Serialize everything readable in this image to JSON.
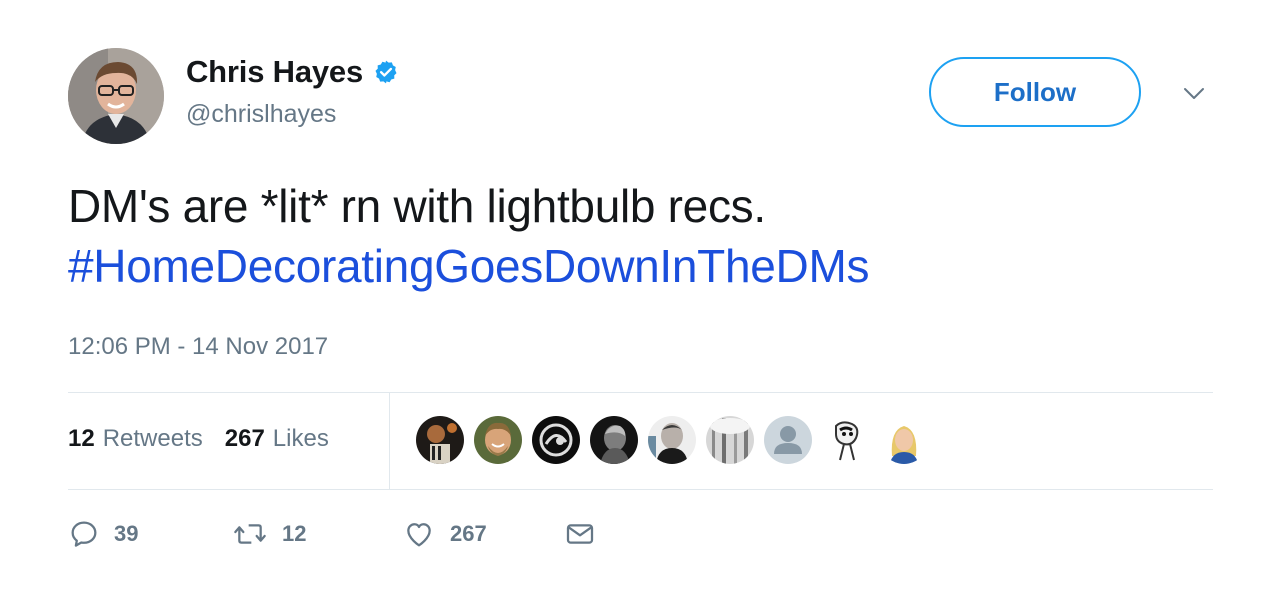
{
  "author": {
    "name": "Chris Hayes",
    "handle": "@chrislhayes",
    "verified": true
  },
  "follow_button": {
    "label": "Follow"
  },
  "tweet": {
    "text": "DM's are *lit* rn with lightbulb recs.",
    "hashtag": "#HomeDecoratingGoesDownInTheDMs",
    "timestamp": "12:06 PM - 14 Nov 2017"
  },
  "stats": {
    "retweets_count": "12",
    "retweets_label": "Retweets",
    "likes_count": "267",
    "likes_label": "Likes"
  },
  "liker_avatars_count": 9,
  "actions": {
    "reply_count": "39",
    "retweet_count": "12",
    "like_count": "267"
  },
  "colors": {
    "accent": "#1da1f2",
    "hashtag": "#1b4fdc",
    "muted": "#657786",
    "divider": "#e1e8ed"
  },
  "icons": [
    "verified-badge-icon",
    "chevron-down-icon",
    "reply-icon",
    "retweet-icon",
    "heart-icon",
    "envelope-icon"
  ]
}
